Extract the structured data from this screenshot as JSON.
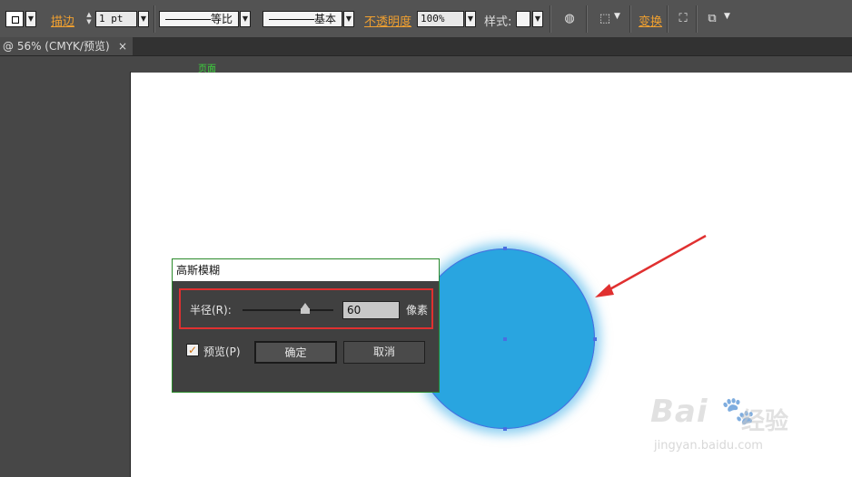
{
  "control_bar": {
    "stroke_label": "描边",
    "stroke_weight": "1 pt",
    "stroke_profile": "等比",
    "brush": "基本",
    "opacity_label": "不透明度",
    "opacity_value": "100%",
    "style_label": "样式:",
    "transform_label": "变换"
  },
  "document_tab": {
    "title": "@ 56% (CMYK/预览)",
    "close": "×"
  },
  "canvas": {
    "artboard_label": "页面",
    "circle_color": "#29a5e0",
    "annotation_color": "#e03030"
  },
  "dialog": {
    "title": "高斯模糊",
    "radius_label": "半径(R):",
    "radius_value": "60",
    "unit": "像素",
    "preview_label": "预览(P)",
    "preview_checked": true,
    "ok_button": "确定",
    "cancel_button": "取消"
  },
  "watermark": {
    "brand": "Bai",
    "brand2": "经验",
    "url": "jingyan.baidu.com"
  }
}
